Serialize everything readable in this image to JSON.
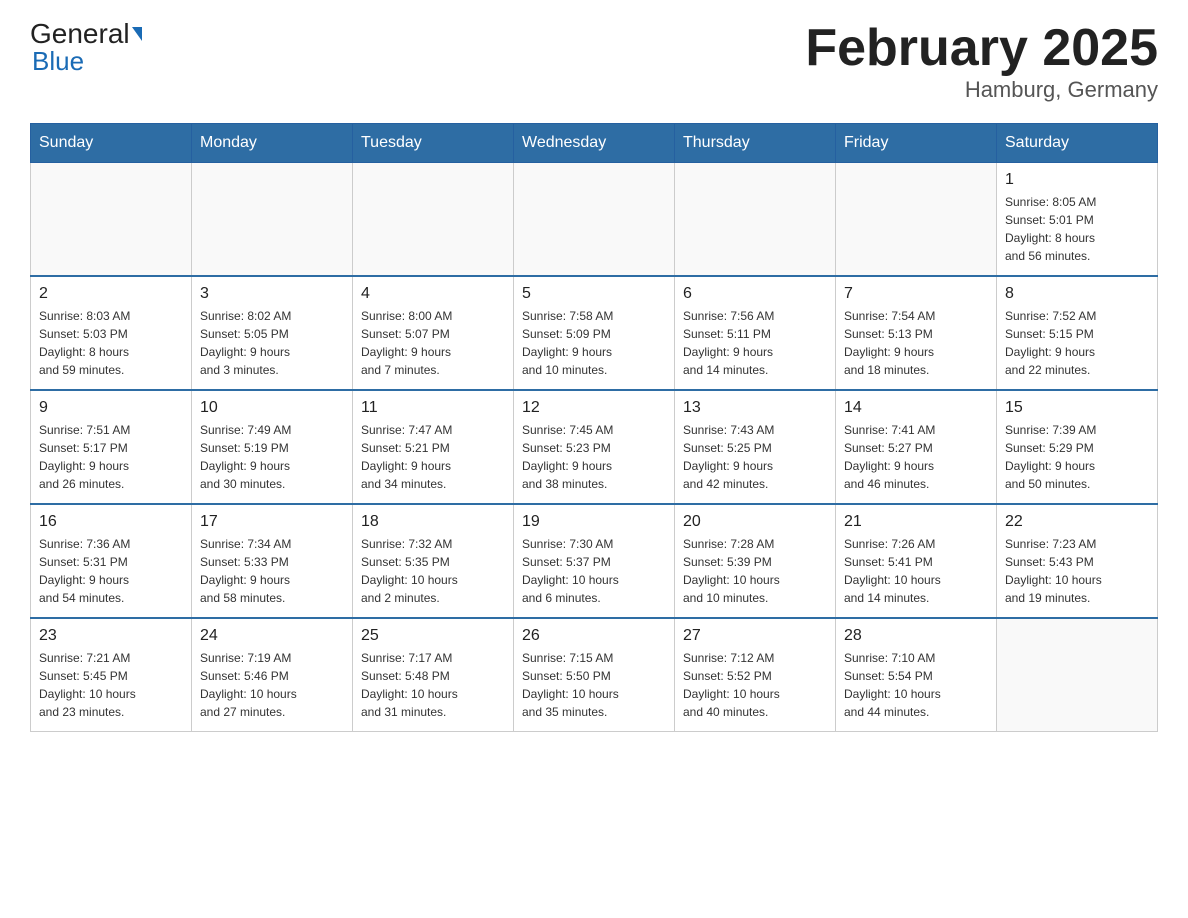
{
  "header": {
    "logo_text_main": "General",
    "logo_text_blue": "Blue",
    "month_title": "February 2025",
    "location": "Hamburg, Germany"
  },
  "weekdays": [
    "Sunday",
    "Monday",
    "Tuesday",
    "Wednesday",
    "Thursday",
    "Friday",
    "Saturday"
  ],
  "weeks": [
    [
      {
        "day": "",
        "info": ""
      },
      {
        "day": "",
        "info": ""
      },
      {
        "day": "",
        "info": ""
      },
      {
        "day": "",
        "info": ""
      },
      {
        "day": "",
        "info": ""
      },
      {
        "day": "",
        "info": ""
      },
      {
        "day": "1",
        "info": "Sunrise: 8:05 AM\nSunset: 5:01 PM\nDaylight: 8 hours\nand 56 minutes."
      }
    ],
    [
      {
        "day": "2",
        "info": "Sunrise: 8:03 AM\nSunset: 5:03 PM\nDaylight: 8 hours\nand 59 minutes."
      },
      {
        "day": "3",
        "info": "Sunrise: 8:02 AM\nSunset: 5:05 PM\nDaylight: 9 hours\nand 3 minutes."
      },
      {
        "day": "4",
        "info": "Sunrise: 8:00 AM\nSunset: 5:07 PM\nDaylight: 9 hours\nand 7 minutes."
      },
      {
        "day": "5",
        "info": "Sunrise: 7:58 AM\nSunset: 5:09 PM\nDaylight: 9 hours\nand 10 minutes."
      },
      {
        "day": "6",
        "info": "Sunrise: 7:56 AM\nSunset: 5:11 PM\nDaylight: 9 hours\nand 14 minutes."
      },
      {
        "day": "7",
        "info": "Sunrise: 7:54 AM\nSunset: 5:13 PM\nDaylight: 9 hours\nand 18 minutes."
      },
      {
        "day": "8",
        "info": "Sunrise: 7:52 AM\nSunset: 5:15 PM\nDaylight: 9 hours\nand 22 minutes."
      }
    ],
    [
      {
        "day": "9",
        "info": "Sunrise: 7:51 AM\nSunset: 5:17 PM\nDaylight: 9 hours\nand 26 minutes."
      },
      {
        "day": "10",
        "info": "Sunrise: 7:49 AM\nSunset: 5:19 PM\nDaylight: 9 hours\nand 30 minutes."
      },
      {
        "day": "11",
        "info": "Sunrise: 7:47 AM\nSunset: 5:21 PM\nDaylight: 9 hours\nand 34 minutes."
      },
      {
        "day": "12",
        "info": "Sunrise: 7:45 AM\nSunset: 5:23 PM\nDaylight: 9 hours\nand 38 minutes."
      },
      {
        "day": "13",
        "info": "Sunrise: 7:43 AM\nSunset: 5:25 PM\nDaylight: 9 hours\nand 42 minutes."
      },
      {
        "day": "14",
        "info": "Sunrise: 7:41 AM\nSunset: 5:27 PM\nDaylight: 9 hours\nand 46 minutes."
      },
      {
        "day": "15",
        "info": "Sunrise: 7:39 AM\nSunset: 5:29 PM\nDaylight: 9 hours\nand 50 minutes."
      }
    ],
    [
      {
        "day": "16",
        "info": "Sunrise: 7:36 AM\nSunset: 5:31 PM\nDaylight: 9 hours\nand 54 minutes."
      },
      {
        "day": "17",
        "info": "Sunrise: 7:34 AM\nSunset: 5:33 PM\nDaylight: 9 hours\nand 58 minutes."
      },
      {
        "day": "18",
        "info": "Sunrise: 7:32 AM\nSunset: 5:35 PM\nDaylight: 10 hours\nand 2 minutes."
      },
      {
        "day": "19",
        "info": "Sunrise: 7:30 AM\nSunset: 5:37 PM\nDaylight: 10 hours\nand 6 minutes."
      },
      {
        "day": "20",
        "info": "Sunrise: 7:28 AM\nSunset: 5:39 PM\nDaylight: 10 hours\nand 10 minutes."
      },
      {
        "day": "21",
        "info": "Sunrise: 7:26 AM\nSunset: 5:41 PM\nDaylight: 10 hours\nand 14 minutes."
      },
      {
        "day": "22",
        "info": "Sunrise: 7:23 AM\nSunset: 5:43 PM\nDaylight: 10 hours\nand 19 minutes."
      }
    ],
    [
      {
        "day": "23",
        "info": "Sunrise: 7:21 AM\nSunset: 5:45 PM\nDaylight: 10 hours\nand 23 minutes."
      },
      {
        "day": "24",
        "info": "Sunrise: 7:19 AM\nSunset: 5:46 PM\nDaylight: 10 hours\nand 27 minutes."
      },
      {
        "day": "25",
        "info": "Sunrise: 7:17 AM\nSunset: 5:48 PM\nDaylight: 10 hours\nand 31 minutes."
      },
      {
        "day": "26",
        "info": "Sunrise: 7:15 AM\nSunset: 5:50 PM\nDaylight: 10 hours\nand 35 minutes."
      },
      {
        "day": "27",
        "info": "Sunrise: 7:12 AM\nSunset: 5:52 PM\nDaylight: 10 hours\nand 40 minutes."
      },
      {
        "day": "28",
        "info": "Sunrise: 7:10 AM\nSunset: 5:54 PM\nDaylight: 10 hours\nand 44 minutes."
      },
      {
        "day": "",
        "info": ""
      }
    ]
  ]
}
